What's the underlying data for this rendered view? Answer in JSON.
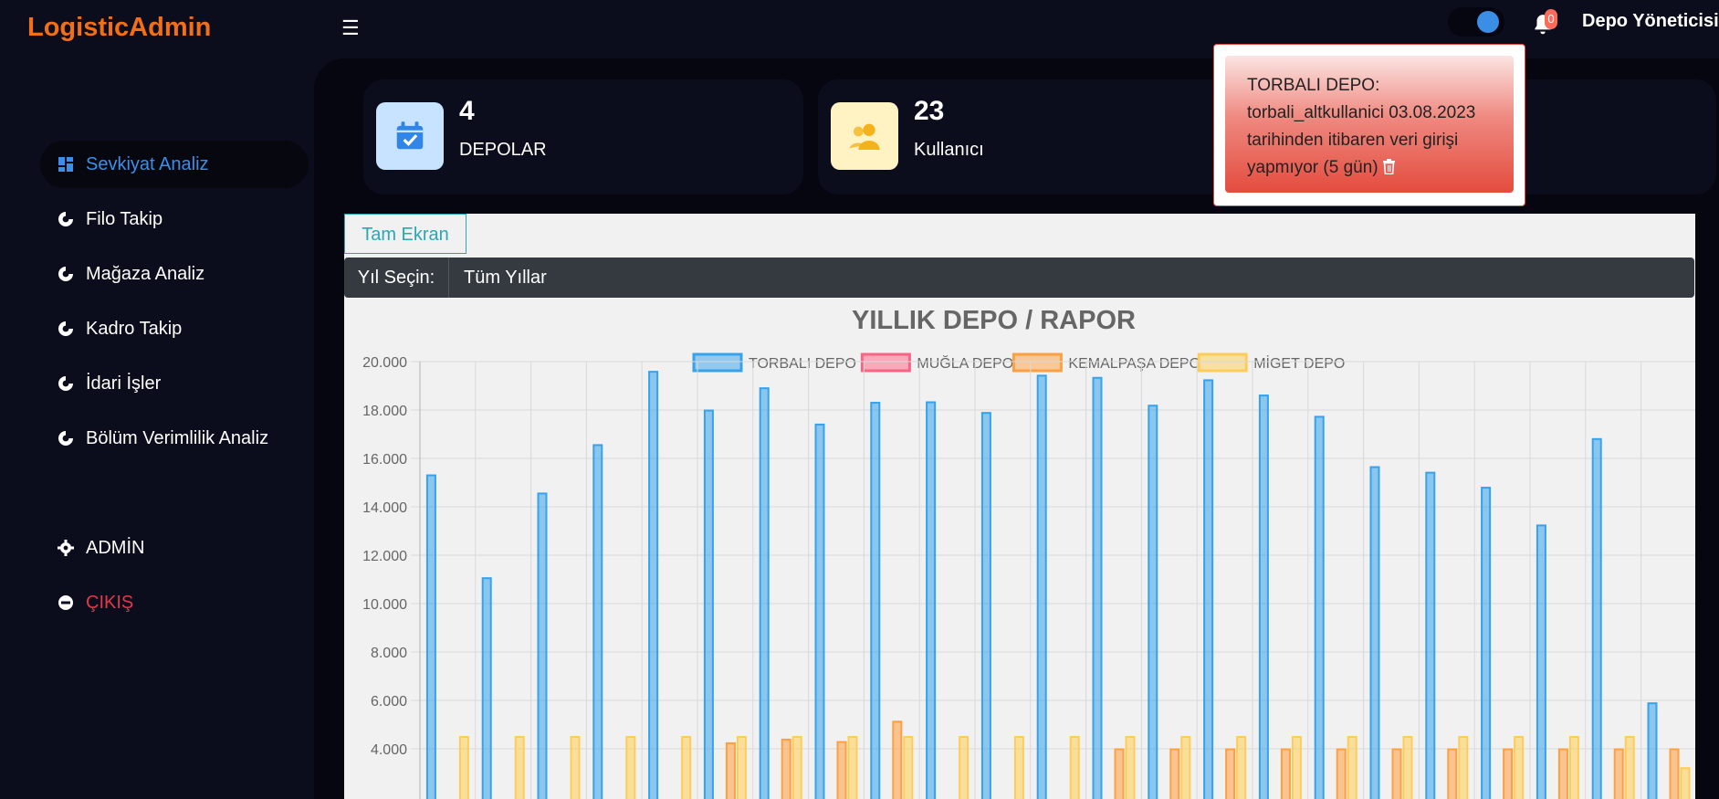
{
  "app": {
    "title": "LogisticAdmin"
  },
  "header": {
    "notification_count": "0",
    "user_name": "Depo Yöneticisi"
  },
  "sidebar": {
    "items": [
      {
        "label": "Sevkiyat Analiz",
        "icon": "dashboard-icon",
        "active": true
      },
      {
        "label": "Filo Takip",
        "icon": "pie-chart-icon"
      },
      {
        "label": "Mağaza Analiz",
        "icon": "pie-chart-icon"
      },
      {
        "label": "Kadro Takip",
        "icon": "pie-chart-icon"
      },
      {
        "label": "İdari İşler",
        "icon": "pie-chart-icon"
      },
      {
        "label": "Bölüm Verimlilik Analiz",
        "icon": "pie-chart-icon"
      },
      {
        "label": "ADMİN",
        "icon": "gear-icon"
      },
      {
        "label": "ÇIKIŞ",
        "icon": "logout-icon"
      }
    ]
  },
  "stats": [
    {
      "value": "4",
      "label": "DEPOLAR",
      "icon": "calendar-check-icon",
      "color": "#c7e3ff"
    },
    {
      "value": "23",
      "label": "Kullanıcı",
      "icon": "users-icon",
      "color": "#fff3c4"
    }
  ],
  "notification": {
    "text": "TORBALI DEPO: torbali_altkullanici 03.08.2023 tarihinden itibaren veri girişi yapmıyor (5 gün)",
    "icon": "trash-icon"
  },
  "controls": {
    "fullscreen_label": "Tam Ekran",
    "year_label": "Yıl Seçin:",
    "year_value": "Tüm Yıllar"
  },
  "chart_data": {
    "type": "bar",
    "title": "YILLIK DEPO / RAPOR",
    "ylim": [
      3000,
      20000
    ],
    "y_ticks": [
      "20.000",
      "18.000",
      "16.000",
      "14.000",
      "12.000",
      "10.000",
      "8.000",
      "6.000",
      "4.000"
    ],
    "y_tick_values": [
      20000,
      18000,
      16000,
      14000,
      12000,
      10000,
      8000,
      6000,
      4000
    ],
    "grid": true,
    "legend": "top",
    "series": [
      {
        "name": "TORBALI DEPO",
        "color": "#36a2eb",
        "values": [
          15300,
          11050,
          14550,
          16550,
          19580,
          17980,
          18900,
          17400,
          18300,
          18320,
          17880,
          19420,
          19330,
          18180,
          19230,
          18600,
          17720,
          15640,
          15410,
          14790,
          13230,
          16800,
          5880
        ]
      },
      {
        "name": "MUĞLA DEPO",
        "color": "#ff6384",
        "values": [
          0,
          0,
          0,
          0,
          0,
          0,
          0,
          0,
          0,
          0,
          0,
          0,
          0,
          0,
          0,
          0,
          0,
          0,
          0,
          0,
          0,
          0,
          0
        ]
      },
      {
        "name": "KEMALPAŞA DEPO",
        "color": "#ff9f40",
        "values": [
          0,
          0,
          0,
          0,
          0,
          4230,
          4380,
          4280,
          5120,
          0,
          0,
          0,
          3980,
          3980,
          3980,
          3980,
          3980,
          3980,
          3980,
          3980,
          3980,
          3980,
          3980
        ]
      },
      {
        "name": "MİGET DEPO",
        "color": "#ffcd56",
        "values": [
          4490,
          4490,
          4490,
          4490,
          4490,
          4490,
          4490,
          4490,
          4490,
          4490,
          4490,
          4490,
          4490,
          4490,
          4490,
          4490,
          4490,
          4490,
          4490,
          4490,
          4490,
          4490,
          3200
        ]
      }
    ]
  }
}
